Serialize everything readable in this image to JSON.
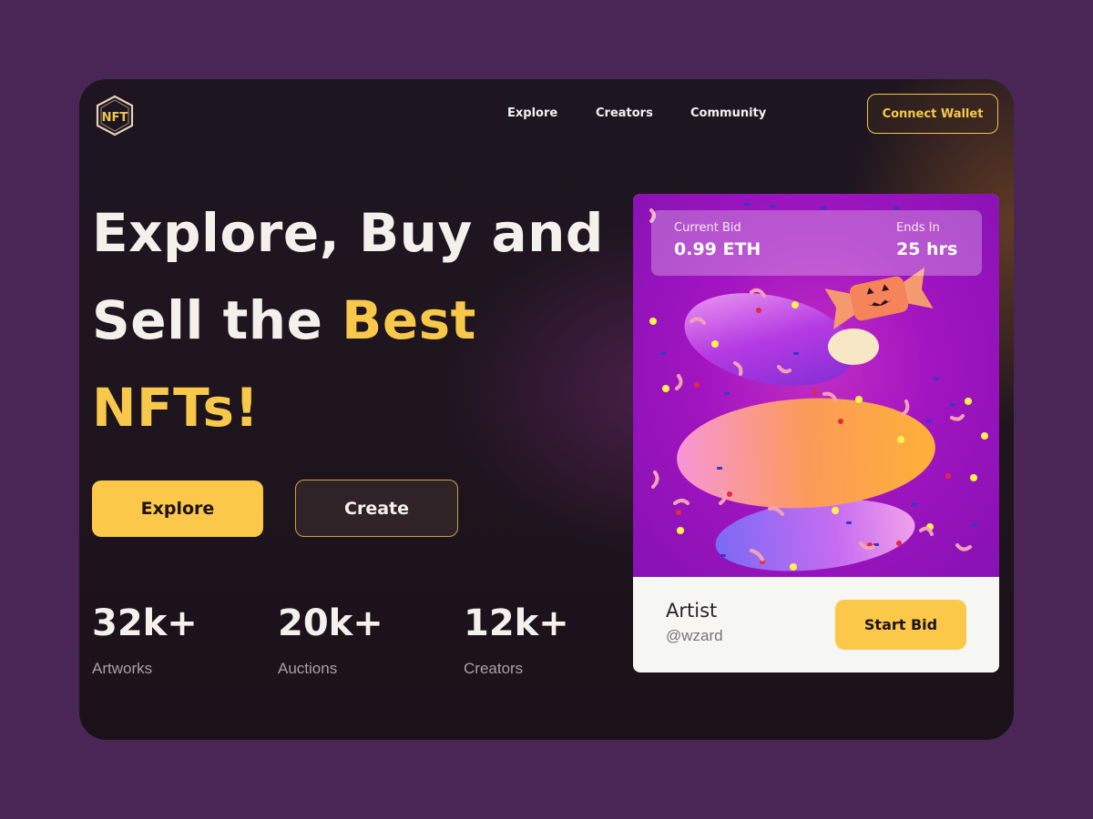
{
  "logo": {
    "text": "NFT",
    "icon": "nft-hexagon-logo"
  },
  "nav": {
    "links": [
      "Explore",
      "Creators",
      "Community"
    ],
    "connect_wallet": "Connect Wallet"
  },
  "hero": {
    "line1": "Explore, Buy and",
    "line2_prefix": "Sell the ",
    "line2_accent": "Best",
    "line3_accent": "NFTs!",
    "explore_button": "Explore",
    "create_button": "Create"
  },
  "stats": [
    {
      "value": "32k+",
      "label": "Artworks"
    },
    {
      "value": "20k+",
      "label": "Auctions"
    },
    {
      "value": "12k+",
      "label": "Creators"
    }
  ],
  "card": {
    "current_bid_label": "Current Bid",
    "current_bid_value": "0.99 ETH",
    "ends_in_label": "Ends In",
    "ends_in_value": "25 hrs",
    "artist_title": "Artist",
    "artist_handle": "@wzard",
    "start_bid_button": "Start Bid"
  },
  "colors": {
    "page_background": "#4a2657",
    "frame_background": "#1d1620",
    "accent_yellow": "#fbc84a",
    "art_magenta": "#a114c0"
  }
}
